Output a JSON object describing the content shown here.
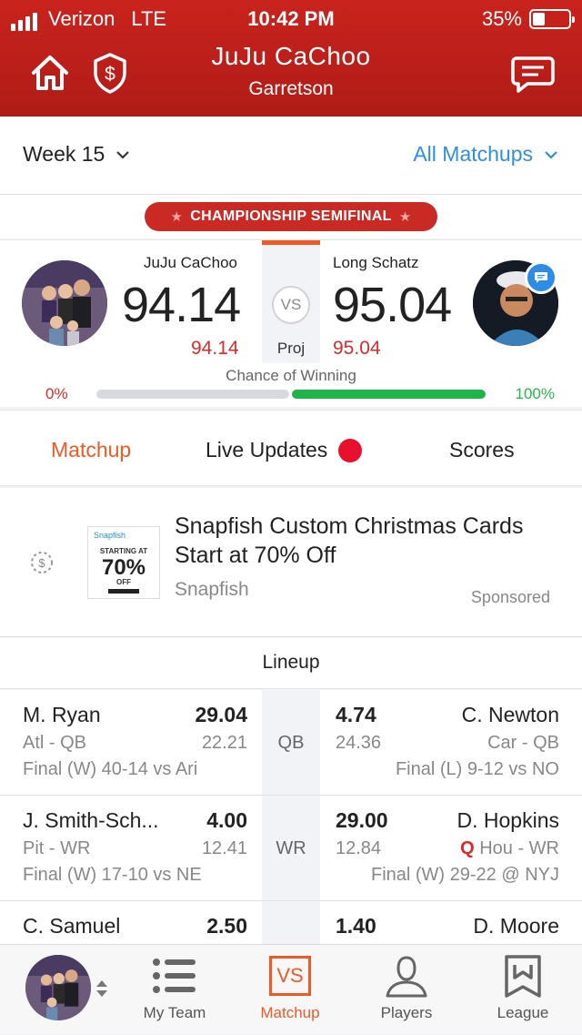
{
  "status_bar": {
    "carrier": "Verizon",
    "network": "LTE",
    "time": "10:42 PM",
    "battery": "35%",
    "battery_fraction": 0.35
  },
  "header": {
    "title": "JuJu CaChoo",
    "subtitle": "Garretson"
  },
  "week": {
    "label": "Week 15",
    "filter": "All Matchups"
  },
  "badge": {
    "label": "CHAMPIONSHIP SEMIFINAL"
  },
  "matchup": {
    "left_team": {
      "name": "JuJu CaChoo",
      "score": "94.14",
      "projected": "94.14",
      "win_chance": "0%"
    },
    "right_team": {
      "name": "Long Schatz",
      "score": "95.04",
      "projected": "95.04",
      "win_chance": "100%"
    },
    "vs_label": "VS",
    "proj_label": "Proj",
    "chance_label": "Chance of Winning",
    "left_win_fraction": 0.0,
    "right_win_fraction": 1.0
  },
  "tabs": {
    "matchup": "Matchup",
    "live": "Live Updates",
    "scores": "Scores"
  },
  "ad": {
    "title": "Snapfish Custom Christmas Cards Start at 70% Off",
    "source": "Snapfish",
    "sponsored": "Sponsored",
    "thumb_brand": "Snapfish",
    "thumb_line1": "STARTING AT",
    "thumb_line2": "70%",
    "thumb_line3": "OFF"
  },
  "lineup": {
    "title": "Lineup",
    "rows": [
      {
        "pos": "QB",
        "left": {
          "name": "M. Ryan",
          "score": "29.04",
          "team_pos": "Atl - QB",
          "proj": "22.21",
          "result": "Final (W) 40-14 vs Ari"
        },
        "right": {
          "name": "C. Newton",
          "score": "4.74",
          "team_pos": "Car - QB",
          "proj": "24.36",
          "result": "Final (L) 9-12 vs NO",
          "status": ""
        }
      },
      {
        "pos": "WR",
        "left": {
          "name": "J. Smith-Sch...",
          "score": "4.00",
          "team_pos": "Pit - WR",
          "proj": "12.41",
          "result": "Final (W) 17-10 vs NE"
        },
        "right": {
          "name": "D. Hopkins",
          "score": "29.00",
          "team_pos": "Hou - WR",
          "proj": "12.84",
          "result": "Final (W) 29-22 @ NYJ",
          "status": "Q"
        }
      },
      {
        "pos": "",
        "left": {
          "name": "C. Samuel",
          "score": "2.50"
        },
        "right": {
          "name": "D. Moore",
          "score": "1.40"
        }
      }
    ]
  },
  "bottom_nav": {
    "my_team": "My Team",
    "matchup": "Matchup",
    "matchup_icon_text": "VS",
    "players": "Players",
    "league": "League"
  },
  "colors": {
    "brand_red": "#c9231d",
    "accent_orange": "#ee5a24",
    "link_blue": "#2f8fe0",
    "win_green": "#1fb34a",
    "loss_red": "#d92b2b"
  }
}
